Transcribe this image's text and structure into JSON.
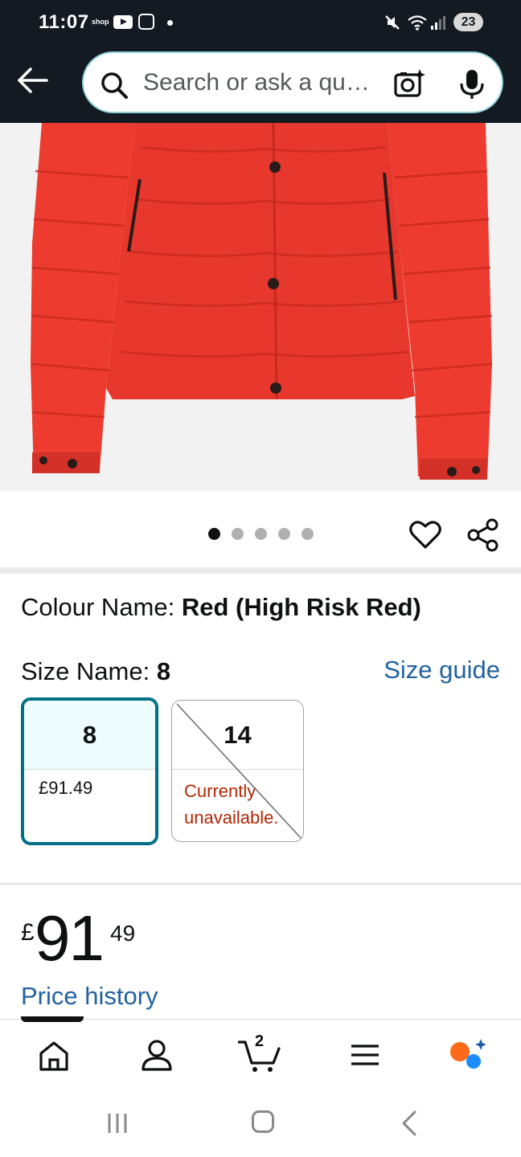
{
  "status_bar": {
    "time": "11:07",
    "shop_label": "shop",
    "battery": "23"
  },
  "search": {
    "placeholder": "Search or ask a question"
  },
  "product_image": {
    "carousel_total": 5,
    "carousel_active": 1
  },
  "variation": {
    "colour_label": "Colour Name: ",
    "colour_value": "Red (High Risk Red)",
    "size_label": "Size Name: ",
    "size_value": "8",
    "size_guide": "Size guide",
    "sizes": [
      {
        "size": "8",
        "detail": "£91.49",
        "selected": true,
        "available": true
      },
      {
        "size": "14",
        "detail": "Currently unavailable.",
        "selected": false,
        "available": false
      }
    ]
  },
  "price": {
    "symbol": "£",
    "whole": "91",
    "fraction": "49",
    "history_link": "Price history"
  },
  "bottom_nav": {
    "cart_count": "2",
    "items": [
      "home-icon",
      "account-icon",
      "cart-icon",
      "menu-icon",
      "rufus-icon"
    ]
  },
  "colors": {
    "header_bg": "#131a22",
    "link": "#2162a1",
    "selected_border": "#007185",
    "selected_fill": "#edfcfe",
    "unavailable_text": "#b12704",
    "jacket_red": "#ee3b2f"
  }
}
